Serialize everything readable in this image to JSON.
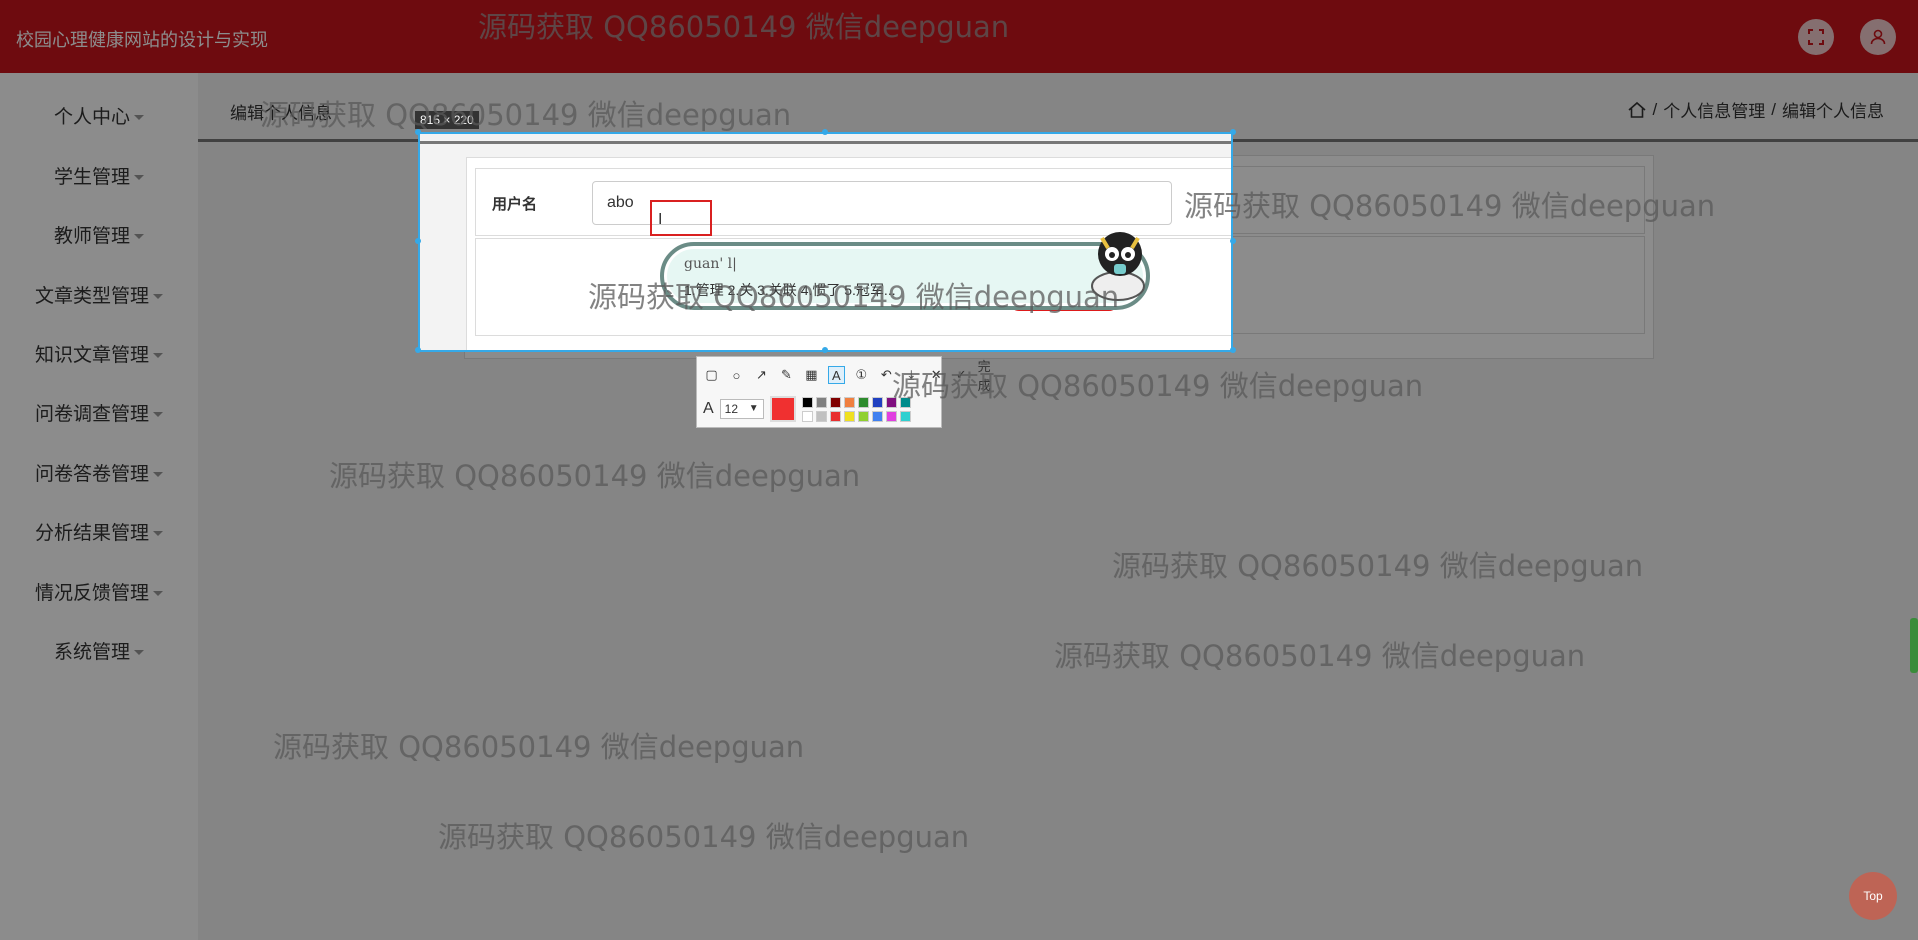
{
  "header": {
    "title": "校园心理健康网站的设计与实现",
    "fullscreen_icon": "expand-icon",
    "user_icon": "user-icon"
  },
  "sidebar": {
    "items": [
      {
        "label": "个人中心"
      },
      {
        "label": "学生管理"
      },
      {
        "label": "教师管理"
      },
      {
        "label": "文章类型管理"
      },
      {
        "label": "知识文章管理"
      },
      {
        "label": "问卷调查管理"
      },
      {
        "label": "问卷答卷管理"
      },
      {
        "label": "分析结果管理"
      },
      {
        "label": "情况反馈管理"
      },
      {
        "label": "系统管理"
      }
    ]
  },
  "main": {
    "heading": "编辑个人信息",
    "breadcrumb": {
      "home_icon": "home-icon",
      "items": [
        "个人信息管理",
        "编辑个人信息"
      ],
      "separator": "/"
    },
    "form": {
      "username_label": "用户名",
      "username_value": "abo"
    }
  },
  "screenshot_tool": {
    "size_label": "815 × 220",
    "ime_input": "guan' l|",
    "ime_candidates": "1.管理   2.关   3.关联   4.惯了   5.冠军...",
    "font_size": "12",
    "done_label": "完成",
    "current_color": "#f03030",
    "palette": [
      "#000000",
      "#808080",
      "#800000",
      "#f08040",
      "#2e8b2e",
      "#2040c0",
      "#801080",
      "#008b8b",
      "#ffffff",
      "#c0c0c0",
      "#e83030",
      "#f0e020",
      "#90d030",
      "#4080f0",
      "#e040e0",
      "#30d0d0"
    ]
  },
  "watermark": {
    "text": "源码获取 QQ86050149 微信deepguan"
  },
  "top_button": "Top"
}
